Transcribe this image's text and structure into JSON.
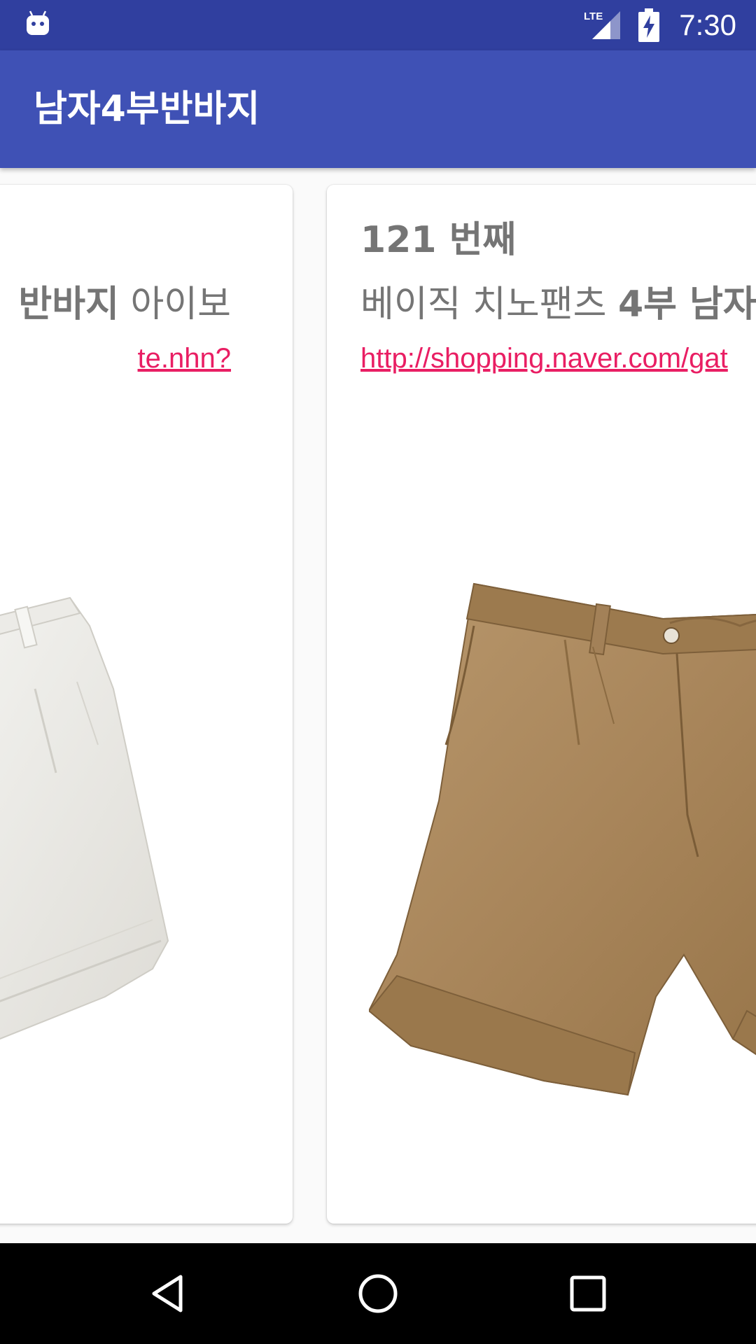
{
  "status_bar": {
    "time": "7:30",
    "network_label": "LTE",
    "icons": [
      "android-debug-icon",
      "lte-signal-icon",
      "battery-charging-icon"
    ]
  },
  "app_bar": {
    "title": "남자4부반바지"
  },
  "cards": {
    "left": {
      "desc_bold": "반바지",
      "desc_rest": " 아이보",
      "link": "te.nhn?",
      "image": "white-shorts-image"
    },
    "right": {
      "number_label": "121 번째",
      "desc_plain": "베이직 치노팬츠 ",
      "desc_bold": "4부 남자",
      "link": "http://shopping.naver.com/gat",
      "image": "khaki-chino-shorts-image"
    }
  },
  "colors": {
    "status_bar": "#303f9f",
    "app_bar": "#3f51b5",
    "link": "#e91e63",
    "text_gray": "#757575"
  },
  "nav_bar": {
    "icons": [
      "back-icon",
      "home-icon",
      "recents-icon"
    ]
  }
}
